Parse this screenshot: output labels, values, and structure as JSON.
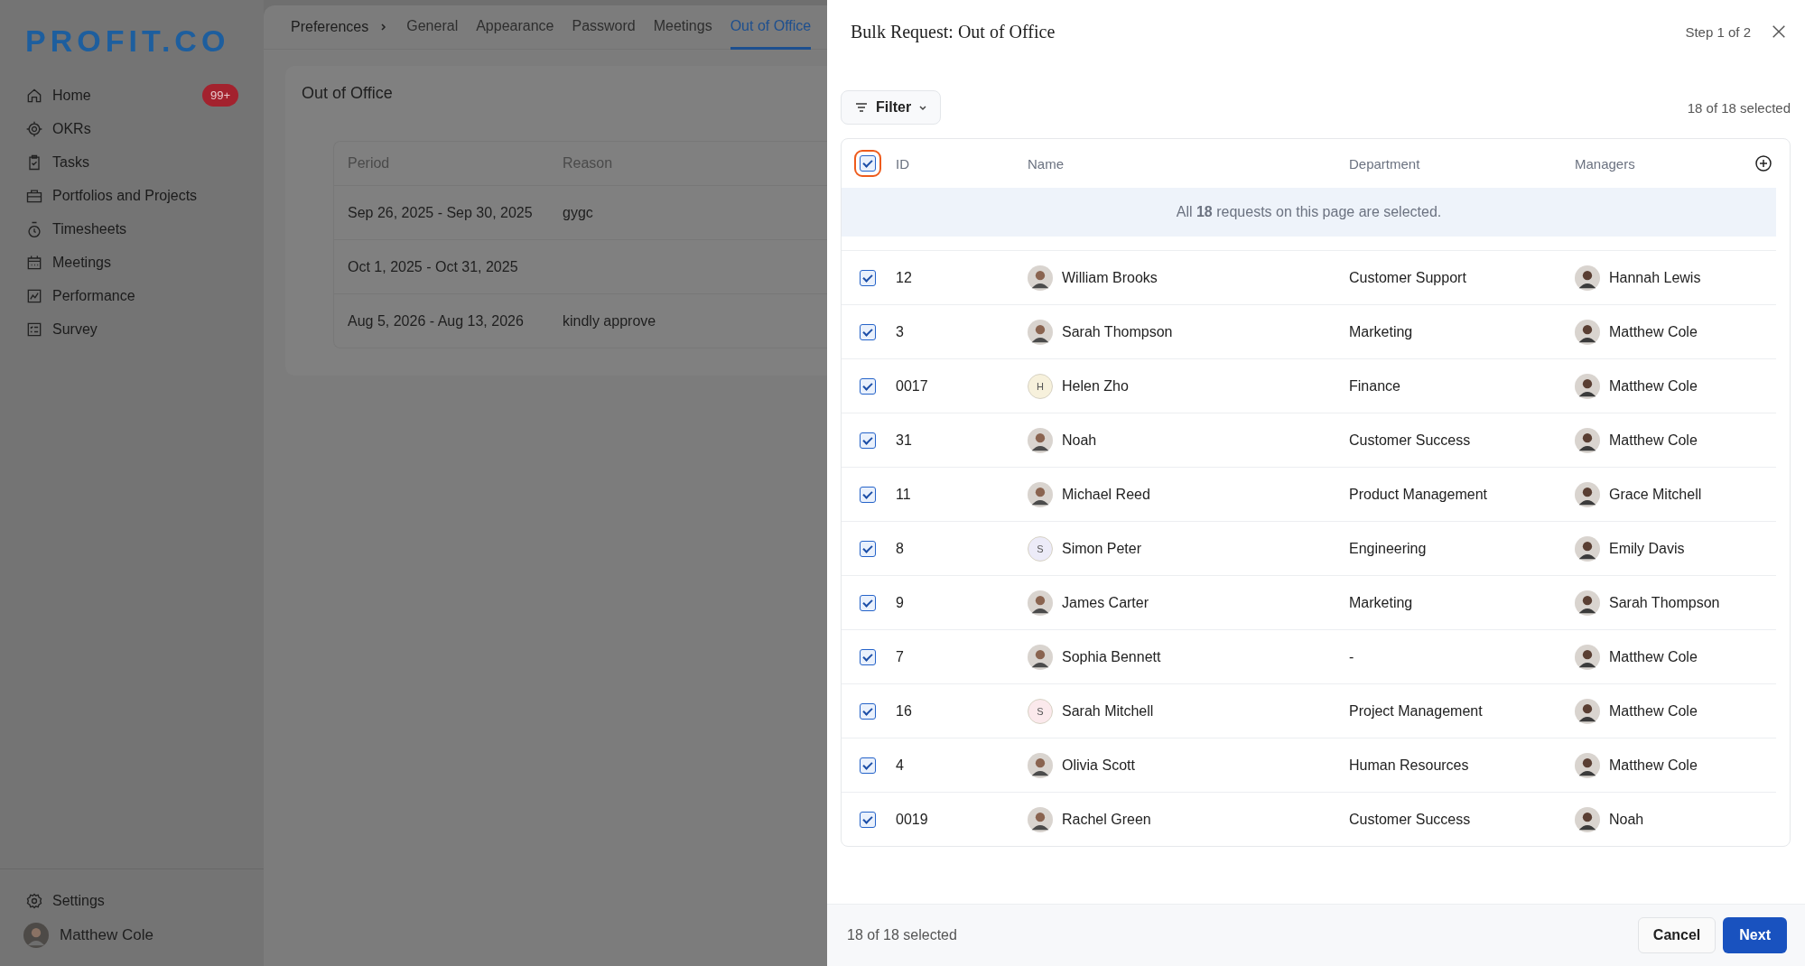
{
  "sidebar": {
    "logo": "PROFIT.CO",
    "items": [
      {
        "label": "Home",
        "badge": "99+"
      },
      {
        "label": "OKRs"
      },
      {
        "label": "Tasks"
      },
      {
        "label": "Portfolios and Projects"
      },
      {
        "label": "Timesheets"
      },
      {
        "label": "Meetings"
      },
      {
        "label": "Performance"
      },
      {
        "label": "Survey"
      }
    ],
    "settings": "Settings",
    "user": "Matthew Cole"
  },
  "breadcrumb": "Preferences",
  "tabs": [
    {
      "label": "General",
      "selected": false
    },
    {
      "label": "Appearance",
      "selected": false
    },
    {
      "label": "Password",
      "selected": false
    },
    {
      "label": "Meetings",
      "selected": false
    },
    {
      "label": "Out of Office",
      "selected": true
    }
  ],
  "card": {
    "title": "Out of Office",
    "columns": [
      "Period",
      "Reason"
    ],
    "rows": [
      [
        "Sep 26, 2025 - Sep 30, 2025",
        "gygc"
      ],
      [
        "Oct 1, 2025 - Oct 31, 2025",
        ""
      ],
      [
        "Aug 5, 2026 - Aug 13, 2026",
        "kindly approve"
      ]
    ]
  },
  "panel": {
    "title": "Bulk Request: Out of Office",
    "step": "Step 1 of 2",
    "filter": "Filter",
    "selected_count": "18 of 18 selected",
    "columns": [
      "ID",
      "Name",
      "Department",
      "Managers"
    ],
    "all_checked": true,
    "banner": "All **18** requests on this page are selected.",
    "rows": [
      {
        "checked": true,
        "id": "12",
        "name": "William Brooks",
        "avatar": {
          "kind": "photo"
        },
        "department": "Customer Support",
        "manager": "Hannah Lewis"
      },
      {
        "checked": true,
        "id": "3",
        "name": "Sarah Thompson",
        "avatar": {
          "kind": "photo"
        },
        "department": "Marketing",
        "manager": "Matthew Cole"
      },
      {
        "checked": true,
        "id": "0017",
        "name": "Helen Zho",
        "avatar": {
          "kind": "initial",
          "initial": "H",
          "color": "#f7f1dc"
        },
        "department": "Finance",
        "manager": "Matthew Cole"
      },
      {
        "checked": true,
        "id": "31",
        "name": "Noah",
        "avatar": {
          "kind": "photo"
        },
        "department": "Customer Success",
        "manager": "Matthew Cole"
      },
      {
        "checked": true,
        "id": "11",
        "name": "Michael Reed",
        "avatar": {
          "kind": "photo"
        },
        "department": "Product Management",
        "manager": "Grace Mitchell"
      },
      {
        "checked": true,
        "id": "8",
        "name": "Simon Peter",
        "avatar": {
          "kind": "initial",
          "initial": "S",
          "color": "#ecebf8"
        },
        "department": "Engineering",
        "manager": "Emily Davis"
      },
      {
        "checked": true,
        "id": "9",
        "name": "James Carter",
        "avatar": {
          "kind": "photo"
        },
        "department": "Marketing",
        "manager": "Sarah Thompson"
      },
      {
        "checked": true,
        "id": "7",
        "name": "Sophia Bennett",
        "avatar": {
          "kind": "photo"
        },
        "department": "-",
        "manager": "Matthew Cole"
      },
      {
        "checked": true,
        "id": "16",
        "name": "Sarah Mitchell",
        "avatar": {
          "kind": "initial",
          "initial": "S",
          "color": "#fbe9ec"
        },
        "department": "Project Management",
        "manager": "Matthew Cole"
      },
      {
        "checked": true,
        "id": "4",
        "name": "Olivia Scott",
        "avatar": {
          "kind": "photo"
        },
        "department": "Human Resources",
        "manager": "Matthew Cole"
      },
      {
        "checked": true,
        "id": "0019",
        "name": "Rachel Green",
        "avatar": {
          "kind": "photo"
        },
        "department": "Customer Success",
        "manager": "Noah"
      }
    ],
    "footer_count": "18 of 18 selected",
    "cancel": "Cancel",
    "next": "Next"
  }
}
